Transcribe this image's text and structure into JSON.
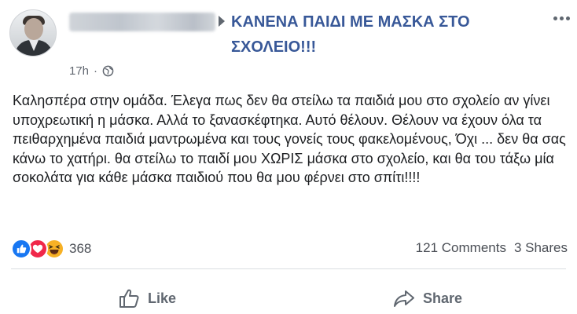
{
  "post": {
    "group_name": "ΚΑΝΕΝΑ ΠΑΙΔΙ ΜΕ ΜΑΣΚΑ ΣΤΟ ΣΧΟΛΕΙΟ!!!",
    "time": "17h",
    "separator": "·",
    "text": "Καλησπέρα στην ομάδα. Έλεγα πως δεν θα στείλω τα παιδιά μου στο σχολείο αν γίνει υποχρεωτική η μάσκα. Αλλά το ξανασκέφτηκα. Αυτό θέλουν. Θέλουν να έχουν όλα τα πειθαρχημένα παιδιά μαντρωμένα και τους γονείς τους φακελομένους, Όχι ... δεν θα σας κάνω το χατήρι. θα στείλω το παιδί μου ΧΩΡΙΣ μάσκα στο σχολείο, και θα του τάξω μία σοκολάτα για κάθε μάσκα παιδιού που θα μου φέρνει στο σπίτι!!!!",
    "reactions_count": "368",
    "comments": "121 Comments",
    "shares": "3 Shares"
  },
  "actions": {
    "like_label": "Like",
    "share_label": "Share"
  },
  "icons": {
    "reactions": [
      "like-icon",
      "love-icon",
      "haha-icon"
    ],
    "privacy": "globe-icon",
    "header_arrow": "arrow-right-icon",
    "menu": "more-icon"
  },
  "colors": {
    "group_link": "#385898",
    "like": "#1877f2",
    "love": "#f0284a",
    "haha": "#f7b125",
    "secondary_text": "#606770"
  }
}
